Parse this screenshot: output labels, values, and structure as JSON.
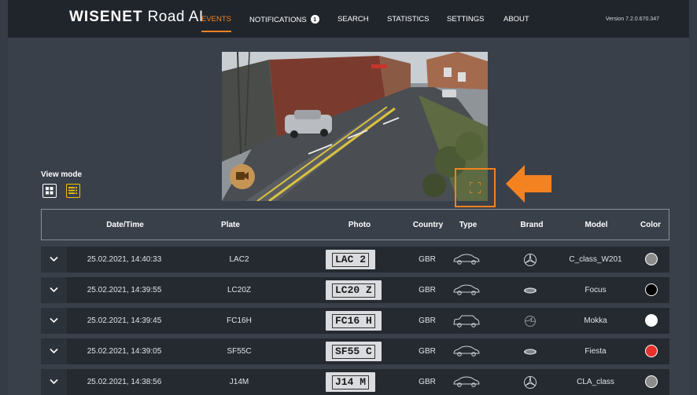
{
  "app": {
    "brand": "WISENET",
    "product": "Road AI",
    "version": "Version 7.2.0.670.347"
  },
  "nav": {
    "events": "EVENTS",
    "notifications": "NOTIFICATIONS",
    "notifications_count": "1",
    "search": "SEARCH",
    "statistics": "STATISTICS",
    "settings": "SETTINGS",
    "about": "ABOUT"
  },
  "colors": {
    "accent": "#f58220",
    "list_view": "#f2c200",
    "header_bg": "#20252c",
    "page_bg": "#39404a"
  },
  "camera": {
    "record_icon": "video-camera-icon",
    "expand_icon": "expand-icon",
    "pointer_icon": "arrow-left-icon"
  },
  "view_mode": {
    "title": "View mode",
    "grid_icon": "grid-icon",
    "list_icon": "list-icon"
  },
  "table": {
    "headers": {
      "datetime": "Date/Time",
      "plate": "Plate",
      "photo": "Photo",
      "country": "Country",
      "type": "Type",
      "brand": "Brand",
      "model": "Model",
      "color": "Color"
    },
    "rows": [
      {
        "datetime": "25.02.2021, 14:40:33",
        "plate": "LAC2",
        "photo": "LAC 2",
        "country": "GBR",
        "type": "car-icon",
        "brand": "mercedes-logo-icon",
        "model": "C_class_W201",
        "color": "#8c8c8c"
      },
      {
        "datetime": "25.02.2021, 14:39:55",
        "plate": "LC20Z",
        "photo": "LC20 Z",
        "country": "GBR",
        "type": "car-icon",
        "brand": "ford-logo-icon",
        "model": "Focus",
        "color": "#000000"
      },
      {
        "datetime": "25.02.2021, 14:39:45",
        "plate": "FC16H",
        "photo": "FC16 H",
        "country": "GBR",
        "type": "suv-icon",
        "brand": "opel-logo-icon",
        "model": "Mokka",
        "color": "#ffffff"
      },
      {
        "datetime": "25.02.2021, 14:39:05",
        "plate": "SF55C",
        "photo": "SF55 C",
        "country": "GBR",
        "type": "car-icon",
        "brand": "ford-logo-icon",
        "model": "Fiesta",
        "color": "#e8312a"
      },
      {
        "datetime": "25.02.2021, 14:38:56",
        "plate": "J14M",
        "photo": "J14 M",
        "country": "GBR",
        "type": "car-icon",
        "brand": "mercedes-logo-icon",
        "model": "CLA_class",
        "color": "#8c8c8c"
      }
    ]
  }
}
